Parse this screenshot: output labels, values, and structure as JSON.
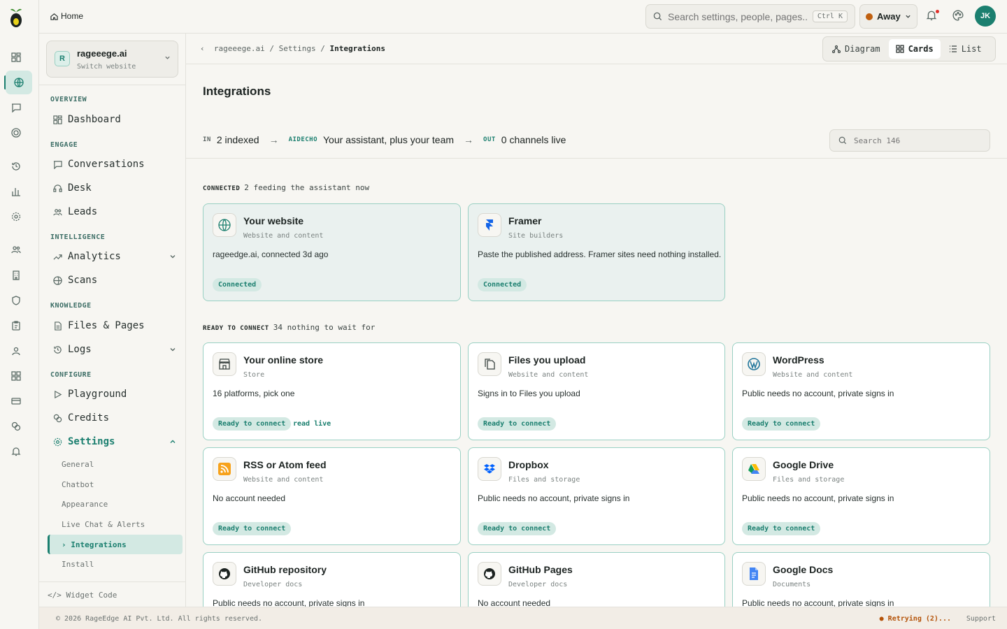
{
  "topbar": {
    "home_label": "Home",
    "search_placeholder": "Search settings, people, pages...",
    "search_shortcut": "Ctrl K",
    "status_label": "Away",
    "avatar_initials": "JK"
  },
  "site": {
    "initial": "R",
    "name": "rageeege.ai",
    "switch_label": "Switch website"
  },
  "sidebar": {
    "sections": [
      "OVERVIEW",
      "ENGAGE",
      "INTELLIGENCE",
      "KNOWLEDGE",
      "CONFIGURE"
    ],
    "items": {
      "dashboard": "Dashboard",
      "conversations": "Conversations",
      "desk": "Desk",
      "leads": "Leads",
      "analytics": "Analytics",
      "scans": "Scans",
      "files": "Files & Pages",
      "logs": "Logs",
      "playground": "Playground",
      "credits": "Credits",
      "settings": "Settings"
    },
    "settings_sub": [
      "General",
      "Chatbot",
      "Appearance",
      "Live Chat & Alerts",
      "Integrations",
      "Install"
    ],
    "current_sub_prefix": "›",
    "widget_code": "Widget Code"
  },
  "breadcrumb": {
    "back": "‹",
    "parts": [
      "rageeege.ai",
      "/",
      "Settings",
      "/"
    ],
    "current": "Integrations"
  },
  "views": {
    "diagram": "Diagram",
    "cards": "Cards",
    "list": "List"
  },
  "page": {
    "title": "Integrations"
  },
  "flow": {
    "in_tag": "IN",
    "in_text": "2 indexed",
    "arrow": "→",
    "mid_tag": "AIDECHO",
    "mid_text": "Your assistant, plus your team",
    "out_tag": "OUT",
    "out_text": "0 channels live",
    "search_placeholder": "Search 146"
  },
  "groups": {
    "connected": {
      "label": "CONNECTED",
      "detail": "2 feeding the assistant now"
    },
    "ready": {
      "label": "READY TO CONNECT",
      "detail": "34 nothing to wait for"
    }
  },
  "connected_cards": [
    {
      "title": "Your website",
      "category": "Website and content",
      "desc": "rageedge.ai, connected 3d ago",
      "badge": "Connected",
      "icon": "globe-icon"
    },
    {
      "title": "Framer",
      "category": "Site builders",
      "desc": "Paste the published address. Framer sites need nothing installed.",
      "badge": "Connected",
      "icon": "framer-icon"
    }
  ],
  "ready_cards": [
    {
      "title": "Your online store",
      "category": "Store",
      "desc": "16 platforms, pick one",
      "badge": "Ready to connect",
      "extra": "read live",
      "icon": "store-icon"
    },
    {
      "title": "Files you upload",
      "category": "Website and content",
      "desc": "Signs in to Files you upload",
      "badge": "Ready to connect",
      "icon": "files-icon"
    },
    {
      "title": "WordPress",
      "category": "Website and content",
      "desc": "Public needs no account, private signs in",
      "badge": "Ready to connect",
      "icon": "wordpress-icon"
    },
    {
      "title": "RSS or Atom feed",
      "category": "Website and content",
      "desc": "No account needed",
      "badge": "Ready to connect",
      "icon": "rss-icon"
    },
    {
      "title": "Dropbox",
      "category": "Files and storage",
      "desc": "Public needs no account, private signs in",
      "badge": "Ready to connect",
      "icon": "dropbox-icon"
    },
    {
      "title": "Google Drive",
      "category": "Files and storage",
      "desc": "Public needs no account, private signs in",
      "badge": "Ready to connect",
      "icon": "google-drive-icon"
    },
    {
      "title": "GitHub repository",
      "category": "Developer docs",
      "desc": "Public needs no account, private signs in",
      "icon": "github-icon"
    },
    {
      "title": "GitHub Pages",
      "category": "Developer docs",
      "desc": "No account needed",
      "icon": "github-icon"
    },
    {
      "title": "Google Docs",
      "category": "Documents",
      "desc": "Public needs no account, private signs in",
      "icon": "google-docs-icon"
    }
  ],
  "footer": {
    "copyright": "© 2026 RageEdge AI Pvt. Ltd. All rights reserved.",
    "status": "● Retrying (2)...",
    "support": "Support"
  },
  "colors": {
    "accent": "#1b7f6f",
    "badge_bg": "#d3e9e3",
    "warning": "#b45309"
  }
}
